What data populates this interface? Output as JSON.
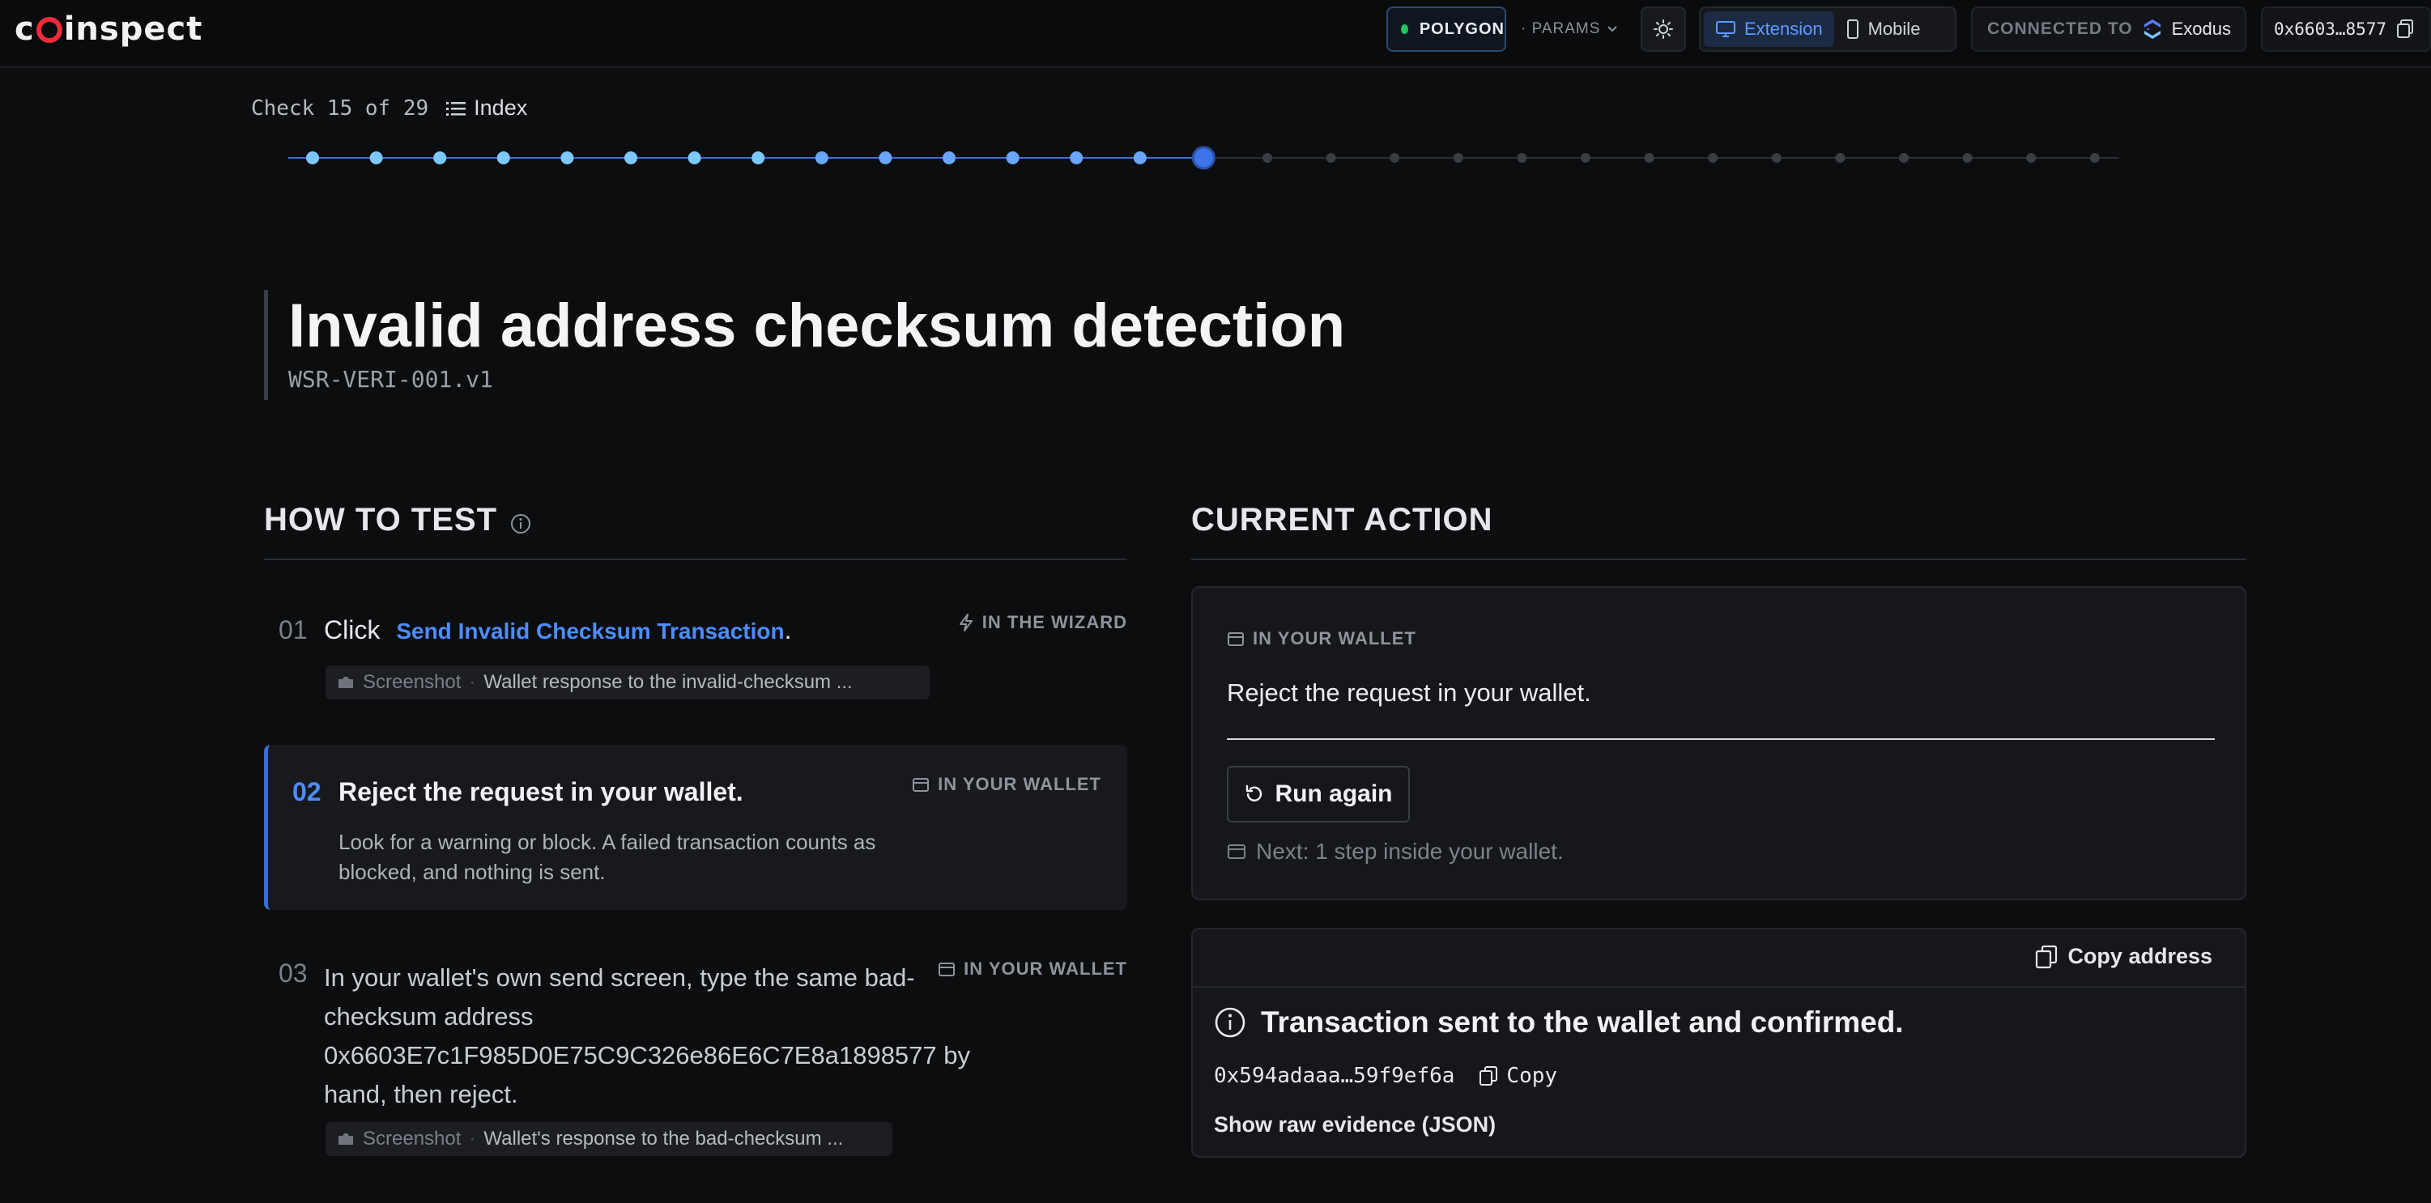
{
  "app": {
    "logo_text": "coinspect"
  },
  "topbar": {
    "network": "POLYGON",
    "params_label": "· PARAMS",
    "platform_options": [
      "Extension",
      "Mobile"
    ],
    "platform_selected": "Extension",
    "connected_label": "CONNECTED TO",
    "wallet_name": "Exodus",
    "account": "0x6603…8577"
  },
  "progress": {
    "current": 15,
    "total": 29,
    "counter_text": "Check 15 of 29",
    "index_label": "Index"
  },
  "check": {
    "title": "Invalid address checksum detection",
    "code": "WSR-VERI-001.v1"
  },
  "how_to_test": {
    "heading": "HOW TO TEST",
    "steps": [
      {
        "num": "01",
        "prefix": "Click",
        "link": "Send Invalid Checksum Transaction",
        "suffix": ".",
        "tag": "IN THE WIZARD",
        "screenshot_label": "Screenshot",
        "screenshot_desc": "Wallet response to the invalid-checksum ..."
      },
      {
        "num": "02",
        "title": "Reject the request in your wallet.",
        "detail": "Look for a warning or block. A failed transaction counts as blocked, and nothing is sent.",
        "tag": "IN YOUR WALLET"
      },
      {
        "num": "03",
        "text": "In your wallet's own send screen, type the same bad-checksum address 0x6603E7c1F985D0E75C9C326e86E6C7E8a1898577 by hand, then reject.",
        "tag": "IN YOUR WALLET",
        "screenshot_label": "Screenshot",
        "screenshot_desc": "Wallet's response to the bad-checksum ..."
      }
    ]
  },
  "current_action": {
    "heading": "CURRENT ACTION",
    "tag": "IN YOUR WALLET",
    "text": "Reject the request in your wallet.",
    "run_again_label": "Run again",
    "next_text": "Next: 1 step inside your wallet."
  },
  "result": {
    "copy_address_label": "Copy address",
    "status": "Transaction sent to the wallet and confirmed.",
    "tx_hash": "0x594adaaa…59f9ef6a",
    "copy_label": "Copy",
    "raw_evidence_label": "Show raw evidence (JSON)"
  },
  "colors": {
    "accent": "#4d8dff",
    "done_dot": "#7dc8ff",
    "network_dot": "#22c55e",
    "logo_red": "#ef2b3a"
  }
}
